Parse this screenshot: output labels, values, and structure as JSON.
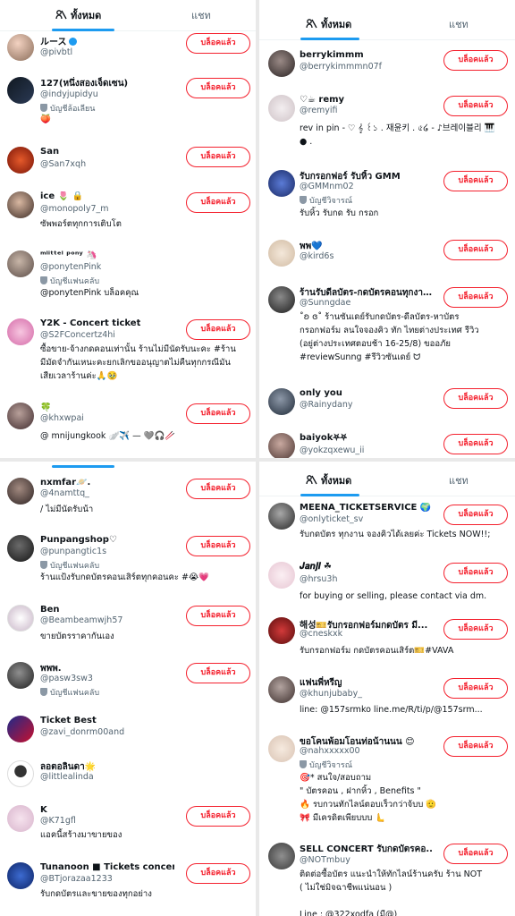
{
  "colors": {
    "blocked": "#f4212e",
    "accent": "#1d9bf0",
    "secondary": "#536471"
  },
  "tabs": {
    "all": "ทั้งหมด",
    "chat": "แชท"
  },
  "blocked_label": "บล็อคแล้ว",
  "panel1": [
    {
      "name": "ルース",
      "handle": "@pivbtl",
      "verified": true
    },
    {
      "name": "127(หนึ่งสองเจ็ดเซน)",
      "handle": "@indyjupidyu",
      "meta": "บัญชีล้อเลียน",
      "bio": "🍑"
    },
    {
      "name": "San",
      "handle": "@San7xqh"
    },
    {
      "name": "ice 🌷 🔒",
      "handle": "@monopoly7_m",
      "bio": "ซัพพอร์ตทุกการเติบโต"
    },
    {
      "name": "ᵐˡⁱᵗᵗᵉˡ ᵖᵒⁿʸ 🦄",
      "handle": "@ponytenPink",
      "meta": "บัญชีแฟนคลับ",
      "bio": "@ponytenPink บล็อคคุณ"
    },
    {
      "name": "Y2K - Concert ticket",
      "handle": "@S2FConcertz4hi",
      "bio": "ซื้อขาย-จ้างกดคอนเท่านั้น ร้านไม่มีนัดรับนะคะ #ร้าน\nมีมัดจำกันเหนะคะยกเลิกขออนุญาตไม่คืนทุกกรณีมัน\nเสียเวลาร้านค่ะ🙏🥹"
    },
    {
      "name": "🍀",
      "handle": "@khxwpai",
      "bio": "@ mnijungkook 🪽✈️ — 🩶🎧🥢"
    }
  ],
  "panel2": [
    {
      "name": "nxmfar🪐.",
      "handle": "@4namttq_",
      "bio": "/ ไม่มีนัดรับน้า"
    },
    {
      "name": "Punpangshop♡",
      "handle": "@punpangtic1s",
      "meta": "บัญชีแฟนคลับ",
      "bio": "ร้านแป้งรับกดบัตรคอนเสิร์ตทุกคอนคะ #😭💗"
    },
    {
      "name": "Ben",
      "handle": "@Beambeamwjh57",
      "bio": "ขายบัตรราคากันเอง"
    },
    {
      "name": "พพพ.",
      "handle": "@pasw3sw3",
      "meta": "บัญชีแฟนคลับ"
    },
    {
      "name": "Ticket Best",
      "handle": "@zavi_donrm00and"
    },
    {
      "name": "ลอตอลินดา🌟",
      "handle": "@littlealinda"
    },
    {
      "name": "K",
      "handle": "@K71gfl",
      "bio": "แอคนี้สร้างมาขายของ"
    },
    {
      "name": "Tunanoon ■ Tickets concert",
      "handle": "@BTjorazaa1233",
      "bio": "รับกดบัตรและขายของทุกอย่าง"
    }
  ],
  "panel3": [
    {
      "name": "berrykimmm",
      "handle": "@berrykimmmn07f"
    },
    {
      "name": "♡☕ remy",
      "handle": "@remyifi",
      "bio": "rev in pin - ♡ 𝄞 ꒰১ . 재윤키 . ৫໒ - ♪브레이블리 🎹\n● ."
    },
    {
      "name": "รับกรอกฟอร์ รับหิ้ว GMM",
      "handle": "@GMMnm02",
      "meta": "บัญชีวิจารณ์",
      "bio": "รับหิ้ว รับกด รับ กรอก"
    },
    {
      "name": "พพ💙",
      "handle": "@kird6s"
    },
    {
      "name": "ร้านรับดีลบัตร-กดบัตรคอนทุกงา…",
      "handle": "@Sunngdae",
      "bio": "˚ʚ ɞ˚ ร้านซันเดย์รับกดบัตร-ดีลบัตร-หาบัตร\nกรอกฟอร์ม ลนใจจองคิว ทัก ไทยต่างประเทศ รีวิว\n(อยู่ต่างประเทศตอบช้า 16-25/8) ขออภัย\n#reviewSunng #รีวิวซันเดย์ ᗢ"
    },
    {
      "name": "only you",
      "handle": "@Rainydany"
    },
    {
      "name": "baiyok⛧⛧",
      "handle": "@yokzqxewu_ii"
    }
  ],
  "panel4": [
    {
      "name": "MEENA_TICKETSERVICE 🌍",
      "handle": "@onlyticket_sv",
      "bio": "รับกดบัตร ทุกงาน จองคิวได้เลยค่ะ Tickets NOW!!;"
    },
    {
      "name": "𝑱𝒂𝒏𝒋𝒊 ☘",
      "handle": "@hrsu3h",
      "bio": "for buying or selling, please contact via dm."
    },
    {
      "name": "해성🎫รับกรอกฟอร์มกดบัตร มี...",
      "handle": "@cneskxk",
      "bio": "รับกรอกฟอร์ม กดบัตรคอนเสิร์ต🎫#VAVA"
    },
    {
      "name": "แฟนพี่หรีญ",
      "handle": "@khunjubaby_",
      "bio": "line: @157srmko line.me/R/ti/p/@157srm..."
    },
    {
      "name": "ขอโคนพ้อมโอนท่อน้านนน 😊",
      "handle": "@nahxxxxx00",
      "meta": "บัญชีวิจารณ์",
      "bio": "🎯* สนใจ/สอบถาม\n\" บัตรคอน , ฝากหิ้ว , Benefits \"\n🔥 รบกวนทักไลน์ตอบเร็วกว่าจ้บบ 🫡\n🎀 มีเครดิตเพียบบบ 🫷"
    },
    {
      "name": "SELL CONCERT รับกดบัตรคอ...",
      "handle": "@NOTmbuy",
      "bio": "ติดต่อซื้อบัตร แนะนำให้ทักไลน์ร้านครับ ร้าน NOT\n( ไม่ใช่มิจฉาชีพแน่นอน )\n\nLine : @322xodfa (มี@)"
    }
  ]
}
